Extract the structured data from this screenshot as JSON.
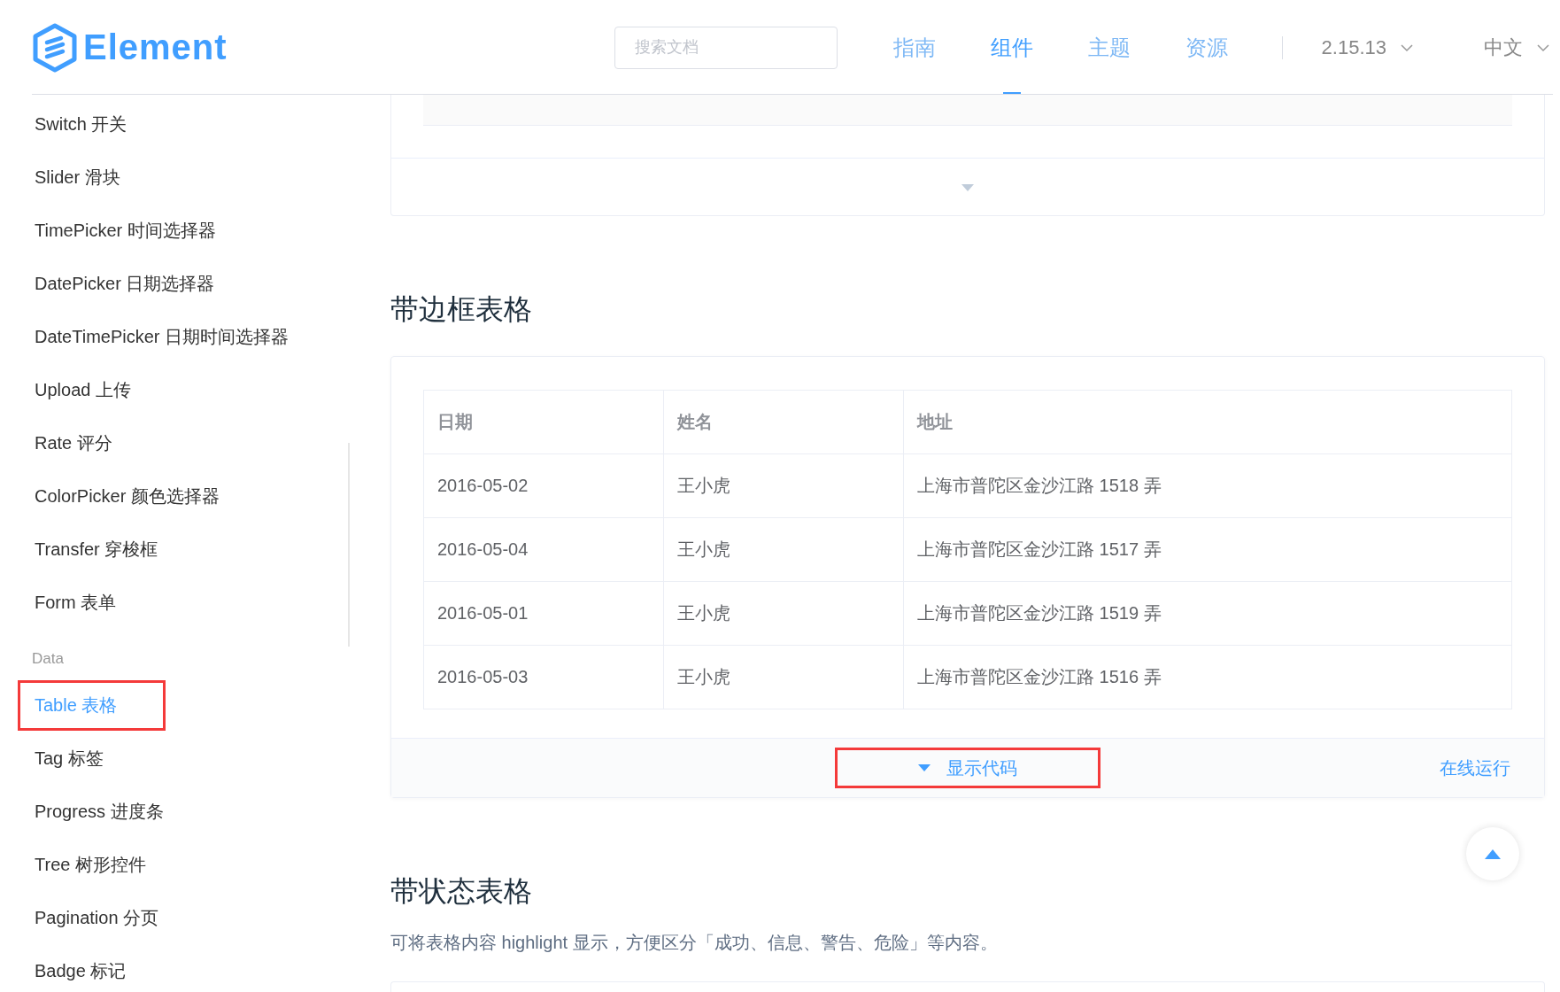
{
  "header": {
    "logo": "Element",
    "search": {
      "placeholder": "搜索文档"
    },
    "nav": [
      {
        "label": "指南",
        "selected": false
      },
      {
        "label": "组件",
        "selected": true
      },
      {
        "label": "主题",
        "selected": false
      },
      {
        "label": "资源",
        "selected": false
      }
    ],
    "version": "2.15.13",
    "language": "中文"
  },
  "sidebar": {
    "items": [
      {
        "kind": "item",
        "label": "Switch 开关",
        "selected": false,
        "highlighted": false
      },
      {
        "kind": "item",
        "label": "Slider 滑块",
        "selected": false,
        "highlighted": false
      },
      {
        "kind": "item",
        "label": "TimePicker 时间选择器",
        "selected": false,
        "highlighted": false
      },
      {
        "kind": "item",
        "label": "DatePicker 日期选择器",
        "selected": false,
        "highlighted": false
      },
      {
        "kind": "item",
        "label": "DateTimePicker 日期时间选择器",
        "selected": false,
        "highlighted": false
      },
      {
        "kind": "item",
        "label": "Upload 上传",
        "selected": false,
        "highlighted": false
      },
      {
        "kind": "item",
        "label": "Rate 评分",
        "selected": false,
        "highlighted": false
      },
      {
        "kind": "item",
        "label": "ColorPicker 颜色选择器",
        "selected": false,
        "highlighted": false
      },
      {
        "kind": "item",
        "label": "Transfer 穿梭框",
        "selected": false,
        "highlighted": false
      },
      {
        "kind": "item",
        "label": "Form 表单",
        "selected": false,
        "highlighted": false
      },
      {
        "kind": "group",
        "label": "Data"
      },
      {
        "kind": "item",
        "label": "Table 表格",
        "selected": true,
        "highlighted": true
      },
      {
        "kind": "item",
        "label": "Tag 标签",
        "selected": false,
        "highlighted": false
      },
      {
        "kind": "item",
        "label": "Progress 进度条",
        "selected": false,
        "highlighted": false
      },
      {
        "kind": "item",
        "label": "Tree 树形控件",
        "selected": false,
        "highlighted": false
      },
      {
        "kind": "item",
        "label": "Pagination 分页",
        "selected": false,
        "highlighted": false
      },
      {
        "kind": "item",
        "label": "Badge 标记",
        "selected": false,
        "highlighted": false
      }
    ]
  },
  "sections": [
    {
      "title": "带边框表格",
      "table": {
        "columns": [
          "日期",
          "姓名",
          "地址"
        ],
        "rows": [
          [
            "2016-05-02",
            "王小虎",
            "上海市普陀区金沙江路 1518 弄"
          ],
          [
            "2016-05-04",
            "王小虎",
            "上海市普陀区金沙江路 1517 弄"
          ],
          [
            "2016-05-01",
            "王小虎",
            "上海市普陀区金沙江路 1519 弄"
          ],
          [
            "2016-05-03",
            "王小虎",
            "上海市普陀区金沙江路 1516 弄"
          ]
        ]
      },
      "show_code": {
        "label": "显示代码",
        "highlighted": true
      },
      "run_online": "在线运行"
    },
    {
      "title": "带状态表格",
      "description": "可将表格内容 highlight 显示，方便区分「成功、信息、警告、危险」等内容。"
    }
  ]
}
